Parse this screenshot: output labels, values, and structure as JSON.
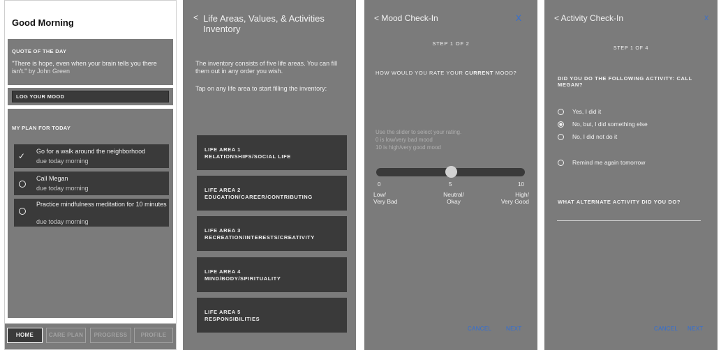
{
  "home": {
    "greeting": "Good Morning",
    "quote_title": "QUOTE OF THE DAY",
    "quote_text": "\"There is hope, even when your brain tells you there isn't.\"",
    "quote_author": "by John Green",
    "log_mood_label": "LOG YOUR MOOD",
    "plan_title": "MY PLAN FOR TODAY",
    "plan_items": [
      {
        "name": "Go for a walk around the neighborhood",
        "due": "due today morning",
        "done": true
      },
      {
        "name": "Call Megan",
        "due": "due today morning",
        "done": false
      },
      {
        "name": "Practice mindfulness meditation for 10 minutes",
        "due": "due today morning",
        "done": false
      }
    ],
    "tabs": [
      "HOME",
      "CARE PLAN",
      "PROGRESS",
      "PROFILE"
    ],
    "active_tab": "HOME",
    "check_icon": "✓"
  },
  "inventory": {
    "back_icon": "<",
    "title": "Life Areas, Values, & Activities Inventory",
    "intro": "The inventory consists of five life areas. You can fill them out in any order you wish.",
    "instruction": "Tap on any life area to start filling the inventory:",
    "areas": [
      {
        "number": "LIFE AREA 1",
        "name": "RELATIONSHIPS/SOCIAL LIFE"
      },
      {
        "number": "LIFE AREA 2",
        "name": "EDUCATION/CAREER/CONTRIBUTING"
      },
      {
        "number": "LIFE AREA 3",
        "name": "RECREATION/INTERESTS/CREATIVITY"
      },
      {
        "number": "LIFE AREA 4",
        "name": "MIND/BODY/SPIRITUALITY"
      },
      {
        "number": "LIFE AREA 5",
        "name": "RESPONSIBILITIES"
      }
    ]
  },
  "mood": {
    "back_title": "< Mood Check-In",
    "close_label": "X",
    "step": "STEP 1 OF 2",
    "question_prefix": "HOW WOULD YOU RATE YOUR ",
    "question_bold": "CURRENT",
    "question_suffix": " MOOD?",
    "hint_1": "Use the slider to select your rating.",
    "hint_2": "0 is low/very bad mood",
    "hint_3": "10 is high/very good mood",
    "slider_value": 5,
    "slider_min": 0,
    "slider_max": 10,
    "tick_min": "0",
    "tick_mid": "5",
    "tick_max": "10",
    "label_low_1": "Low/",
    "label_low_2": "Very Bad",
    "label_mid_1": "Neutral/",
    "label_mid_2": "Okay",
    "label_high_1": "High/",
    "label_high_2": "Very Good",
    "cancel_label": "CANCEL",
    "next_label": "NEXT",
    "accent_color": "#2f6ed8"
  },
  "activity": {
    "back_title": "< Activity Check-In",
    "close_label": "X",
    "step": "STEP 1 OF 4",
    "question": "DID YOU DO THE FOLLOWING ACTIVITY: CALL MEGAN?",
    "options": [
      {
        "label": "Yes, I did it",
        "selected": false
      },
      {
        "label": "No, but, I did something else",
        "selected": true
      },
      {
        "label": "No, I did not do it",
        "selected": false
      }
    ],
    "remind_label": "Remind me again tomorrow",
    "alt_question": "WHAT ALTERNATE ACTIVITY DID YOU DO?",
    "alt_value": "",
    "cancel_label": "CANCEL",
    "next_label": "NEXT"
  }
}
